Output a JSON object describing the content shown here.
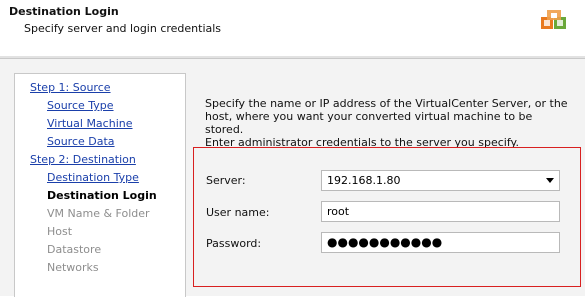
{
  "header": {
    "title": "Destination Login",
    "subtitle": "Specify server and login credentials",
    "logo_icon": "vmware-converter-icon"
  },
  "sidebar": {
    "items": [
      {
        "label": "Step 1: Source",
        "state": "link"
      },
      {
        "label": "Source Type",
        "state": "link"
      },
      {
        "label": "Virtual Machine",
        "state": "link"
      },
      {
        "label": "Source Data",
        "state": "link"
      },
      {
        "label": "Step 2: Destination",
        "state": "link"
      },
      {
        "label": "Destination Type",
        "state": "link"
      },
      {
        "label": "Destination Login",
        "state": "current"
      },
      {
        "label": "VM Name & Folder",
        "state": "disabled"
      },
      {
        "label": "Host",
        "state": "disabled"
      },
      {
        "label": "Datastore",
        "state": "disabled"
      },
      {
        "label": "Networks",
        "state": "disabled"
      }
    ]
  },
  "main": {
    "description_lines": [
      "Specify the name or IP address of the VirtualCenter Server, or the",
      "host, where you want your converted virtual machine to be stored.",
      "Enter administrator credentials to the server you specify."
    ],
    "form": {
      "server_label": "Server:",
      "server_value": "192.168.1.80",
      "username_label": "User name:",
      "username_value": "root",
      "password_label": "Password:",
      "password_value": "●●●●●●●●●●●"
    },
    "highlight_color": "#d82020"
  }
}
